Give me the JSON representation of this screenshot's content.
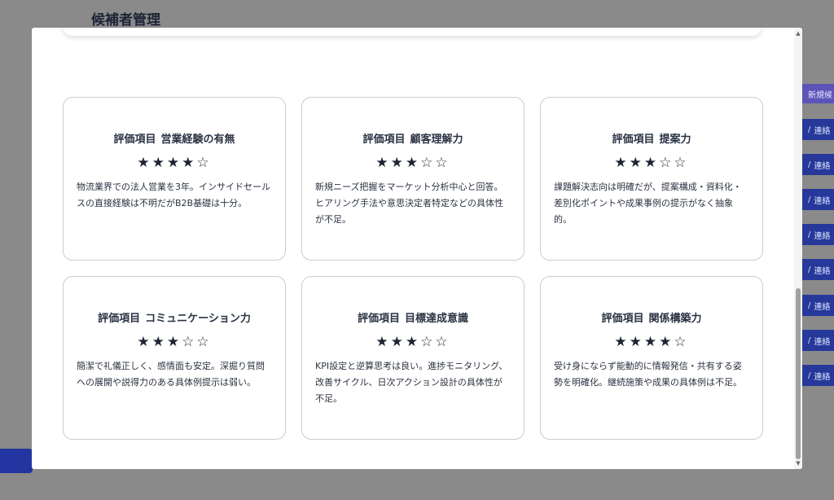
{
  "background": {
    "page_title": "候補者管理",
    "new_button_label": "新規候",
    "contact_label": "連絡",
    "contact_rows": [
      1,
      2,
      3,
      4,
      5,
      6,
      7,
      8
    ]
  },
  "cards": [
    {
      "label": "評価項目",
      "item": "営業経験の有無",
      "rating": 4,
      "max": 5,
      "comment": "物流業界での法人営業を3年。インサイドセールスの直接経験は不明だがB2B基礎は十分。"
    },
    {
      "label": "評価項目",
      "item": "顧客理解力",
      "rating": 3,
      "max": 5,
      "comment": "新規ニーズ把握をマーケット分析中心と回答。ヒアリング手法や意思決定者特定などの具体性が不足。"
    },
    {
      "label": "評価項目",
      "item": "提案力",
      "rating": 3,
      "max": 5,
      "comment": "課題解決志向は明確だが、提案構成・資料化・差別化ポイントや成果事例の提示がなく抽象的。"
    },
    {
      "label": "評価項目",
      "item": "コミュニケーション力",
      "rating": 3,
      "max": 5,
      "comment": "簡潔で礼儀正しく、感情面も安定。深掘り質問への展開や説得力のある具体例提示は弱い。"
    },
    {
      "label": "評価項目",
      "item": "目標達成意識",
      "rating": 3,
      "max": 5,
      "comment": "KPI設定と逆算思考は良い。進捗モニタリング、改善サイクル、日次アクション設計の具体性が不足。"
    },
    {
      "label": "評価項目",
      "item": "関係構築力",
      "rating": 4,
      "max": 5,
      "comment": "受け身にならず能動的に情報発信・共有する姿勢を明確化。継続施策や成果の具体例は不足。"
    }
  ],
  "scrollbar": {
    "up_icon": "▲",
    "down_icon": "▼"
  }
}
